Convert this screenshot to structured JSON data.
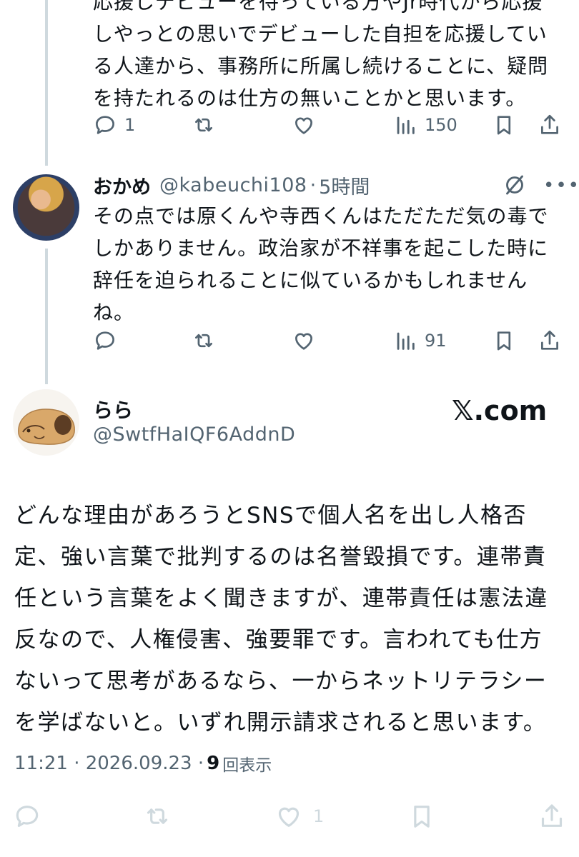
{
  "tweet1": {
    "text": "応援しデビューを待っている方やJr時代から応援\nしやっとの思いでデビューした自担を応援してい\nる人達から、事務所に所属し続けることに、疑問\nを持たれるのは仕方の無いことかと思います。",
    "reply_count": "1",
    "views_count": "150"
  },
  "tweet2": {
    "name": "おかめ",
    "handle": "@kabeuchi108",
    "dot": "·",
    "time": "5時間",
    "text": "その点では原くんや寺西くんはただただ気の毒で\nしかありません。政治家が不祥事を起こした時に\n辞任を迫られることに似ているかもしれません\nね。",
    "views_count": "91"
  },
  "main_tweet": {
    "name": "らら",
    "handle": "@SwtfHaIQF6AddnD",
    "watermark": "𝕏.com",
    "text": "どんな理由があろうとSNSで個人名を出し人格否\n定、強い言葉で批判するのは名誉毀損です。連帯責\n任という言葉をよく聞きますが、連帯責任は憲法違\n反なので、人権侵害、強要罪です。言われても仕方\nないって思考があるなら、一からネットリテラシー\nを学ばないと。いずれ開示請求されると思います。",
    "timestamp": "11:21 · 2026.09.23 ·",
    "views_number": "9",
    "views_label": "回表示",
    "like_count": "1"
  },
  "icons": {
    "reply": "reply-icon",
    "retweet": "retweet-icon",
    "like": "heart-icon",
    "views": "views-icon",
    "bookmark": "bookmark-icon",
    "share": "share-icon",
    "grok": "grok-icon",
    "more": "more-icon"
  },
  "colors": {
    "text": "#0f1419",
    "secondary": "#536471",
    "thread_line": "#cfd9de",
    "inactive_icon": "#cfd9de"
  }
}
